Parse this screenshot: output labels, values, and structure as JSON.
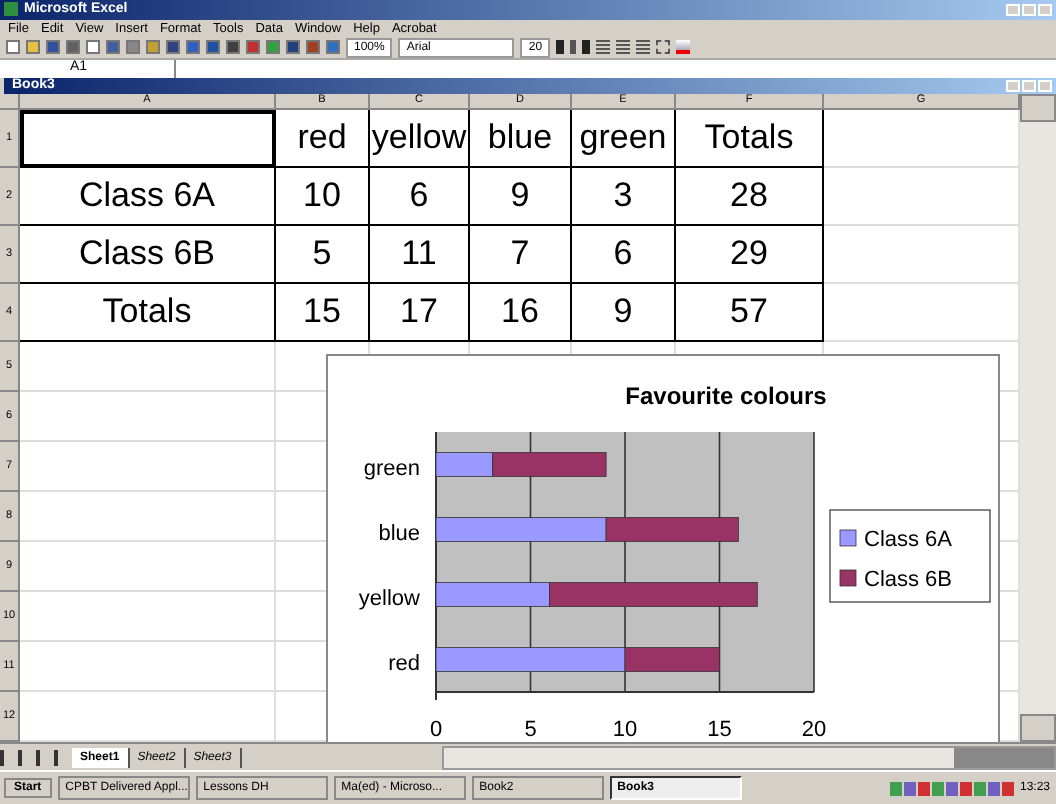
{
  "window": {
    "title": "Microsoft Excel"
  },
  "menu": [
    "File",
    "Edit",
    "View",
    "Insert",
    "Format",
    "Tools",
    "Data",
    "Window",
    "Help",
    "Acrobat"
  ],
  "toolbar": {
    "zoom": "100%",
    "font": "Arial",
    "font_size": "20"
  },
  "formula_bar": {
    "name_box": "A1"
  },
  "workbook": {
    "title": "Book3"
  },
  "sheet": {
    "columns": [
      "A",
      "B",
      "C",
      "D",
      "E",
      "F",
      "G"
    ],
    "row_numbers": [
      "1",
      "2",
      "3",
      "4",
      "5",
      "6",
      "7",
      "8",
      "9",
      "10",
      "11",
      "12"
    ],
    "header_row": [
      "red",
      "yellow",
      "blue",
      "green",
      "Totals"
    ],
    "rows": [
      {
        "label": "Class 6A",
        "values": [
          "10",
          "6",
          "9",
          "3",
          "28"
        ]
      },
      {
        "label": "Class 6B",
        "values": [
          "5",
          "11",
          "7",
          "6",
          "29"
        ]
      },
      {
        "label": "Totals",
        "values": [
          "15",
          "17",
          "16",
          "9",
          "57"
        ]
      }
    ]
  },
  "chart": {
    "chart_data": {
      "type": "bar",
      "orientation": "horizontal",
      "stacked": true,
      "title": "Favourite colours",
      "categories": [
        "green",
        "blue",
        "yellow",
        "red"
      ],
      "series": [
        {
          "name": "Class 6A",
          "color": "#9999ff",
          "values": [
            3,
            9,
            6,
            10
          ]
        },
        {
          "name": "Class 6B",
          "color": "#993366",
          "values": [
            6,
            7,
            11,
            5
          ]
        }
      ],
      "xlim": [
        0,
        20
      ],
      "xticks": [
        0,
        5,
        10,
        15,
        20
      ],
      "grid": true,
      "legend": true
    }
  },
  "sheet_tabs": [
    {
      "label": "Sheet1",
      "selected": true
    },
    {
      "label": "Sheet2",
      "selected": false
    },
    {
      "label": "Sheet3",
      "selected": false
    }
  ],
  "taskbar": {
    "start": "Start",
    "buttons": [
      {
        "label": "CPBT Delivered Appl...",
        "selected": false
      },
      {
        "label": "Lessons DH",
        "selected": false
      },
      {
        "label": "Ma(ed) - Microso...",
        "selected": false
      },
      {
        "label": "Book2",
        "selected": false
      },
      {
        "label": "Book3",
        "selected": true
      }
    ],
    "clock": "13:23"
  }
}
